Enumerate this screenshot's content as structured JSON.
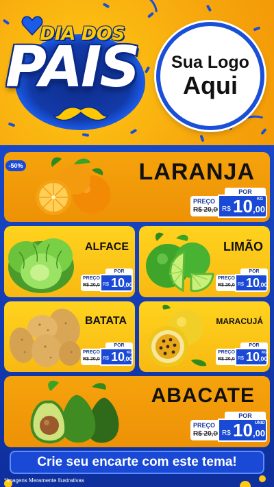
{
  "header": {
    "title_top": "DIA DOS",
    "title_main": "PAIS",
    "logo_line1": "Sua Logo",
    "logo_line2": "Aqui"
  },
  "colors": {
    "orange": "#F5A30C",
    "yellow": "#FFD31E",
    "blue": "#1A49D6",
    "navy": "#0E2F9C"
  },
  "products": [
    {
      "name": "LARANJA",
      "discount": "-50%",
      "price_label": "POR",
      "old_label": "PREÇO",
      "old_price": "R$ 20,00",
      "currency": "R$",
      "price_int": "10",
      "price_dec": ",00",
      "unit": "KG",
      "icon": "orange-fruit-icon"
    },
    {
      "name": "ALFACE",
      "price_label": "POR",
      "old_label": "PREÇO",
      "old_price": "R$ 20,00",
      "currency": "R$",
      "price_int": "10",
      "price_dec": ",00",
      "unit": "",
      "icon": "lettuce-icon"
    },
    {
      "name": "LIMÃO",
      "price_label": "POR",
      "old_label": "PREÇO",
      "old_price": "R$ 20,00",
      "currency": "R$",
      "price_int": "10",
      "price_dec": ",00",
      "unit": "",
      "icon": "lime-icon"
    },
    {
      "name": "BATATA",
      "price_label": "POR",
      "old_label": "PREÇO",
      "old_price": "R$ 20,00",
      "currency": "R$",
      "price_int": "10",
      "price_dec": ",00",
      "unit": "KG",
      "icon": "potato-icon"
    },
    {
      "name": "MARACUJÁ",
      "price_label": "POR",
      "old_label": "PREÇO",
      "old_price": "R$ 20,00",
      "currency": "R$",
      "price_int": "10",
      "price_dec": ",00",
      "unit": "KG",
      "icon": "passion-fruit-icon"
    },
    {
      "name": "ABACATE",
      "price_label": "POR",
      "old_label": "PREÇO",
      "old_price": "R$ 20,00",
      "currency": "R$",
      "price_int": "10",
      "price_dec": ",00",
      "unit": "UNID",
      "icon": "avocado-icon"
    }
  ],
  "cta": "Crie seu encarte com este tema!",
  "disclaimer": "*Imagens Meramente Ilustrativas"
}
